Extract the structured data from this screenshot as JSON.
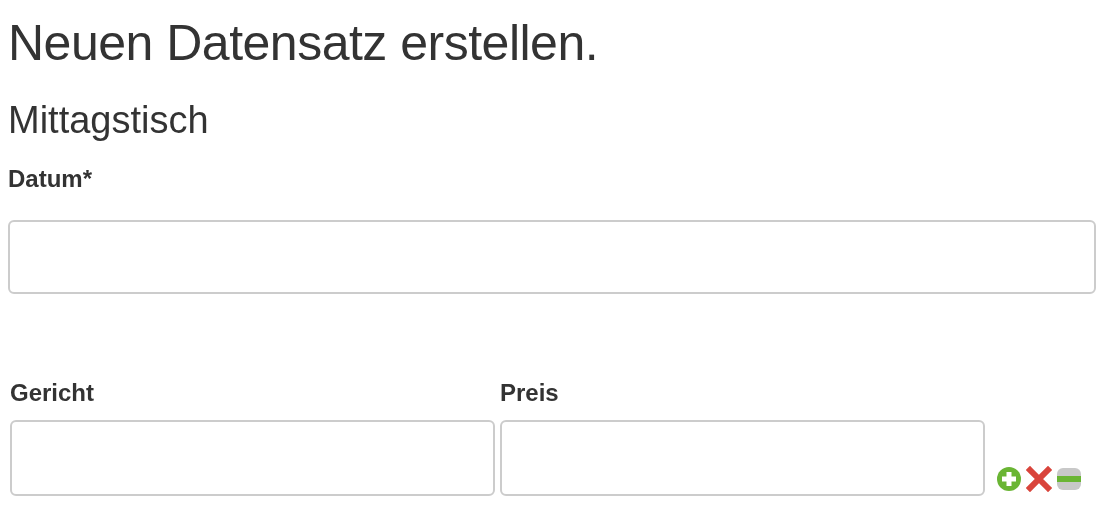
{
  "title": "Neuen Datensatz erstellen.",
  "subtitle": "Mittagstisch",
  "date_field": {
    "label": "Datum*"
  },
  "row_fields": [
    {
      "label": "Gericht"
    },
    {
      "label": "Preis"
    }
  ]
}
